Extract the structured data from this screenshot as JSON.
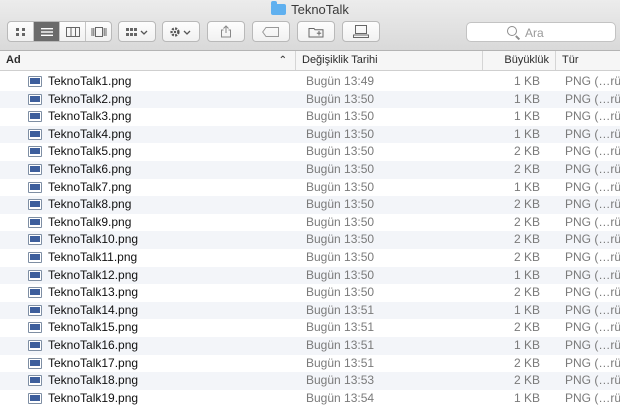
{
  "window": {
    "title": "TeknoTalk"
  },
  "toolbar": {
    "search_placeholder": "Ara"
  },
  "columns": {
    "name": "Ad",
    "date": "Değişiklik Tarihi",
    "size": "Büyüklük",
    "kind": "Tür"
  },
  "files": [
    {
      "name": "TeknoTalk1.png",
      "date": "Bugün 13:49",
      "size": "1 KB",
      "kind": "PNG (…rüntü)"
    },
    {
      "name": "TeknoTalk2.png",
      "date": "Bugün 13:50",
      "size": "1 KB",
      "kind": "PNG (…rüntü)"
    },
    {
      "name": "TeknoTalk3.png",
      "date": "Bugün 13:50",
      "size": "1 KB",
      "kind": "PNG (…rüntü)"
    },
    {
      "name": "TeknoTalk4.png",
      "date": "Bugün 13:50",
      "size": "1 KB",
      "kind": "PNG (…rüntü)"
    },
    {
      "name": "TeknoTalk5.png",
      "date": "Bugün 13:50",
      "size": "2 KB",
      "kind": "PNG (…rüntü)"
    },
    {
      "name": "TeknoTalk6.png",
      "date": "Bugün 13:50",
      "size": "2 KB",
      "kind": "PNG (…rüntü)"
    },
    {
      "name": "TeknoTalk7.png",
      "date": "Bugün 13:50",
      "size": "1 KB",
      "kind": "PNG (…rüntü)"
    },
    {
      "name": "TeknoTalk8.png",
      "date": "Bugün 13:50",
      "size": "2 KB",
      "kind": "PNG (…rüntü)"
    },
    {
      "name": "TeknoTalk9.png",
      "date": "Bugün 13:50",
      "size": "2 KB",
      "kind": "PNG (…rüntü)"
    },
    {
      "name": "TeknoTalk10.png",
      "date": "Bugün 13:50",
      "size": "2 KB",
      "kind": "PNG (…rüntü)"
    },
    {
      "name": "TeknoTalk11.png",
      "date": "Bugün 13:50",
      "size": "2 KB",
      "kind": "PNG (…rüntü)"
    },
    {
      "name": "TeknoTalk12.png",
      "date": "Bugün 13:50",
      "size": "1 KB",
      "kind": "PNG (…rüntü)"
    },
    {
      "name": "TeknoTalk13.png",
      "date": "Bugün 13:50",
      "size": "2 KB",
      "kind": "PNG (…rüntü)"
    },
    {
      "name": "TeknoTalk14.png",
      "date": "Bugün 13:51",
      "size": "1 KB",
      "kind": "PNG (…rüntü)"
    },
    {
      "name": "TeknoTalk15.png",
      "date": "Bugün 13:51",
      "size": "2 KB",
      "kind": "PNG (…rüntü)"
    },
    {
      "name": "TeknoTalk16.png",
      "date": "Bugün 13:51",
      "size": "1 KB",
      "kind": "PNG (…rüntü)"
    },
    {
      "name": "TeknoTalk17.png",
      "date": "Bugün 13:51",
      "size": "2 KB",
      "kind": "PNG (…rüntü)"
    },
    {
      "name": "TeknoTalk18.png",
      "date": "Bugün 13:53",
      "size": "2 KB",
      "kind": "PNG (…rüntü)"
    },
    {
      "name": "TeknoTalk19.png",
      "date": "Bugün 13:54",
      "size": "1 KB",
      "kind": "PNG (…rüntü)"
    }
  ]
}
